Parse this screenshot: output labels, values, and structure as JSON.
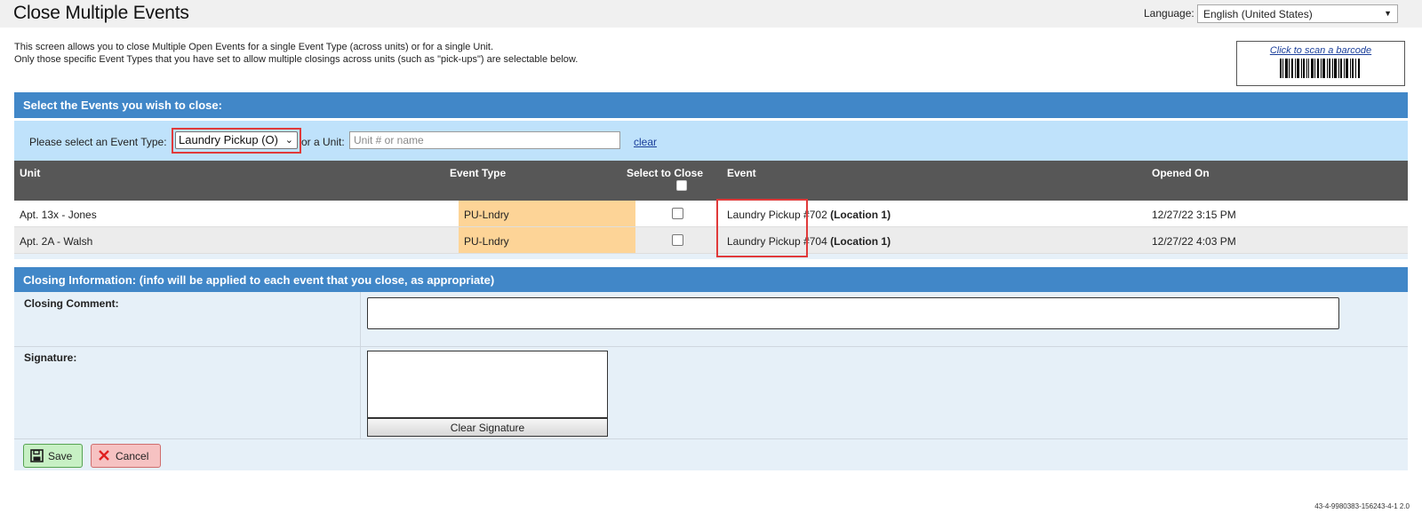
{
  "header": {
    "title": "Close Multiple Events",
    "language_label": "Language:",
    "language_value": "English (United States)"
  },
  "intro": {
    "line1": "This screen allows you to close Multiple Open Events for a single Event Type (across units) or for a single Unit.",
    "line2": "Only those specific Event Types that you have set to allow multiple closings across units (such as \"pick-ups\") are selectable below."
  },
  "barcode": {
    "link_text": "Click to scan a barcode"
  },
  "select_section": {
    "title": "Select the Events you wish to close:",
    "event_type_label": "Please select an Event Type:",
    "event_type_value": "Laundry Pickup (O)",
    "or_unit_label": "or a Unit:",
    "unit_placeholder": "Unit # or name",
    "clear_label": "clear"
  },
  "grid": {
    "columns": [
      "Unit",
      "Event Type",
      "Select to Close",
      "Event",
      "Opened On"
    ],
    "rows": [
      {
        "unit": "Apt. 13x - Jones",
        "event_type": "PU-Lndry",
        "selected": false,
        "event": "Laundry Pickup #702",
        "location": "(Location 1)",
        "opened_on": "12/27/22 3:15 PM"
      },
      {
        "unit": "Apt. 2A - Walsh",
        "event_type": "PU-Lndry",
        "selected": false,
        "event": "Laundry Pickup #704",
        "location": "(Location 1)",
        "opened_on": "12/27/22 4:03 PM"
      }
    ]
  },
  "closing": {
    "title": "Closing Information: (info will be applied to each event that you close, as appropriate)",
    "comment_label": "Closing Comment:",
    "comment_value": "",
    "signature_label": "Signature:",
    "clear_signature_label": "Clear Signature",
    "save_label": "Save",
    "cancel_label": "Cancel"
  },
  "footer": {
    "version": "43-4-9980383-156243-4-1 2.0"
  },
  "colors": {
    "section_header": "#4187c8",
    "filter_bg": "#bfe2fb",
    "grid_header": "#575757",
    "event_type_cell": "#fdd497",
    "highlight": "#e03a3a"
  }
}
